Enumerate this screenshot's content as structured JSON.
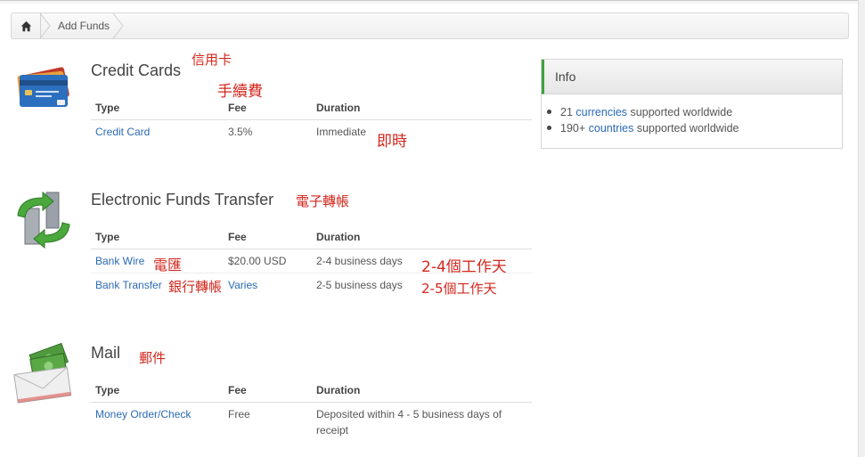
{
  "breadcrumb": {
    "home_icon": "home-icon",
    "current": "Add Funds"
  },
  "sections": {
    "credit": {
      "title": "Credit Cards",
      "annot_title": "信用卡",
      "annot_fee": "手續費",
      "headers": {
        "type": "Type",
        "fee": "Fee",
        "duration": "Duration"
      },
      "rows": [
        {
          "type": "Credit Card",
          "fee": "3.5%",
          "duration": "Immediate",
          "annot": "即時"
        }
      ]
    },
    "eft": {
      "title": "Electronic Funds Transfer",
      "annot_title": "電子轉帳",
      "headers": {
        "type": "Type",
        "fee": "Fee",
        "duration": "Duration"
      },
      "rows": [
        {
          "type": "Bank Wire",
          "type_annot": "電匯",
          "fee": "$20.00 USD",
          "duration": "2-4 business days",
          "annot": "2-4個工作天"
        },
        {
          "type": "Bank Transfer",
          "type_annot": "銀行轉帳",
          "fee": "Varies",
          "duration": "2-5 business days",
          "annot": "2-5個工作天"
        }
      ]
    },
    "mail": {
      "title": "Mail",
      "annot_title": "郵件",
      "headers": {
        "type": "Type",
        "fee": "Fee",
        "duration": "Duration"
      },
      "rows": [
        {
          "type": "Money Order/Check",
          "fee": "Free",
          "duration_line1": "Deposited within 4 - 5 business days of",
          "duration_line2": "receipt"
        }
      ]
    }
  },
  "info": {
    "title": "Info",
    "items": [
      {
        "prefix": "21 ",
        "link": "currencies",
        "suffix": " supported worldwide"
      },
      {
        "prefix": "190+ ",
        "link": "countries",
        "suffix": " supported worldwide"
      }
    ]
  },
  "icons": {
    "credit": "credit-cards-icon",
    "eft": "transfer-arrows-icon",
    "mail": "money-envelope-icon"
  },
  "colors": {
    "link": "#2a6ab6",
    "annotation": "#d2281e",
    "info_accent": "#3da13d"
  }
}
